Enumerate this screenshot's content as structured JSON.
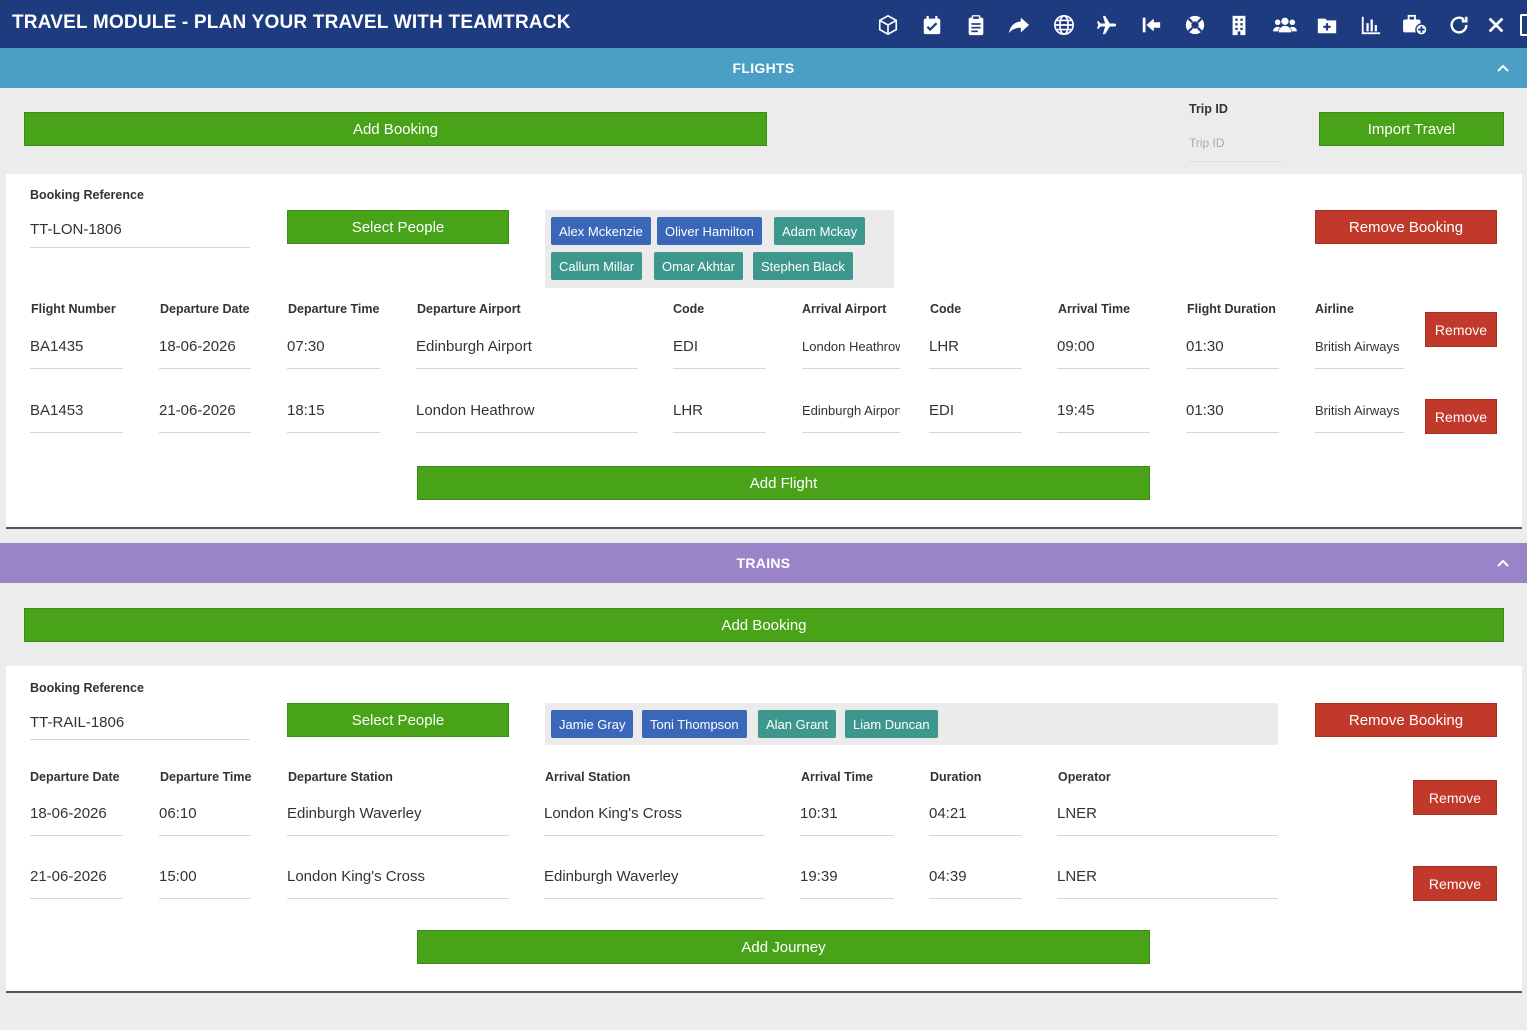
{
  "app": {
    "title": "TRAVEL MODULE - PLAN YOUR TRAVEL WITH TEAMTRACK"
  },
  "toolbar": {
    "icons": [
      "cube-icon",
      "calendar-check-icon",
      "clipboard-icon",
      "share-icon",
      "globe-icon",
      "plane-icon",
      "arrow-left-to-bar-icon",
      "life-ring-icon",
      "building-icon",
      "users-icon",
      "folder-plus-icon",
      "bar-chart-icon",
      "briefcase-plus-icon",
      "refresh-icon",
      "close-icon"
    ]
  },
  "flights": {
    "header": "FLIGHTS",
    "add_booking_label": "Add Booking",
    "trip_id_label": "Trip ID",
    "trip_id_placeholder": "Trip ID",
    "import_label": "Import Travel",
    "booking": {
      "ref_label": "Booking Reference",
      "ref_value": "TT-LON-1806",
      "select_people_label": "Select People",
      "remove_booking_label": "Remove Booking",
      "people": [
        {
          "name": "Alex Mckenzie",
          "color": "blue"
        },
        {
          "name": "Oliver Hamilton",
          "color": "blue"
        },
        {
          "name": "Adam Mckay",
          "color": "teal"
        },
        {
          "name": "Callum Millar",
          "color": "teal"
        },
        {
          "name": "Omar Akhtar",
          "color": "teal"
        },
        {
          "name": "Stephen Black",
          "color": "teal"
        }
      ],
      "columns": [
        "Flight Number",
        "Departure Date",
        "Departure Time",
        "Departure Airport",
        "Code",
        "Arrival Airport",
        "Code",
        "Arrival Time",
        "Flight Duration",
        "Airline"
      ],
      "rows": [
        {
          "flight_number": "BA1435",
          "departure_date": "18-06-2026",
          "departure_time": "07:30",
          "departure_airport": "Edinburgh Airport",
          "dep_code": "EDI",
          "arrival_airport": "London Heathrow",
          "arr_code": "LHR",
          "arrival_time": "09:00",
          "duration": "01:30",
          "airline": "British Airways",
          "remove_label": "Remove"
        },
        {
          "flight_number": "BA1453",
          "departure_date": "21-06-2026",
          "departure_time": "18:15",
          "departure_airport": "London Heathrow",
          "dep_code": "LHR",
          "arrival_airport": "Edinburgh Airport",
          "arr_code": "EDI",
          "arrival_time": "19:45",
          "duration": "01:30",
          "airline": "British Airways",
          "remove_label": "Remove"
        }
      ],
      "add_flight_label": "Add Flight"
    }
  },
  "trains": {
    "header": "TRAINS",
    "add_booking_label": "Add Booking",
    "booking": {
      "ref_label": "Booking Reference",
      "ref_value": "TT-RAIL-1806",
      "select_people_label": "Select People",
      "remove_booking_label": "Remove Booking",
      "people": [
        {
          "name": "Jamie Gray",
          "color": "blue"
        },
        {
          "name": "Toni Thompson",
          "color": "blue"
        },
        {
          "name": "Alan Grant",
          "color": "teal"
        },
        {
          "name": "Liam Duncan",
          "color": "teal"
        }
      ],
      "columns": [
        "Departure Date",
        "Departure Time",
        "Departure Station",
        "Arrival Station",
        "Arrival Time",
        "Duration",
        "Operator"
      ],
      "rows": [
        {
          "departure_date": "18-06-2026",
          "departure_time": "06:10",
          "departure_station": "Edinburgh Waverley",
          "arrival_station": "London King's Cross",
          "arrival_time": "10:31",
          "duration": "04:21",
          "operator": "LNER",
          "remove_label": "Remove"
        },
        {
          "departure_date": "21-06-2026",
          "departure_time": "15:00",
          "departure_station": "London King's Cross",
          "arrival_station": "Edinburgh Waverley",
          "arrival_time": "19:39",
          "duration": "04:39",
          "operator": "LNER",
          "remove_label": "Remove"
        }
      ],
      "add_journey_label": "Add Journey"
    }
  },
  "colors": {
    "topbar": "#1d3b7e",
    "flights_header": "#4b9fc4",
    "trains_header": "#9a83c9",
    "green": "#48a318",
    "red": "#c0392b",
    "chip_blue": "#3a67b8",
    "chip_teal": "#3d978c"
  }
}
